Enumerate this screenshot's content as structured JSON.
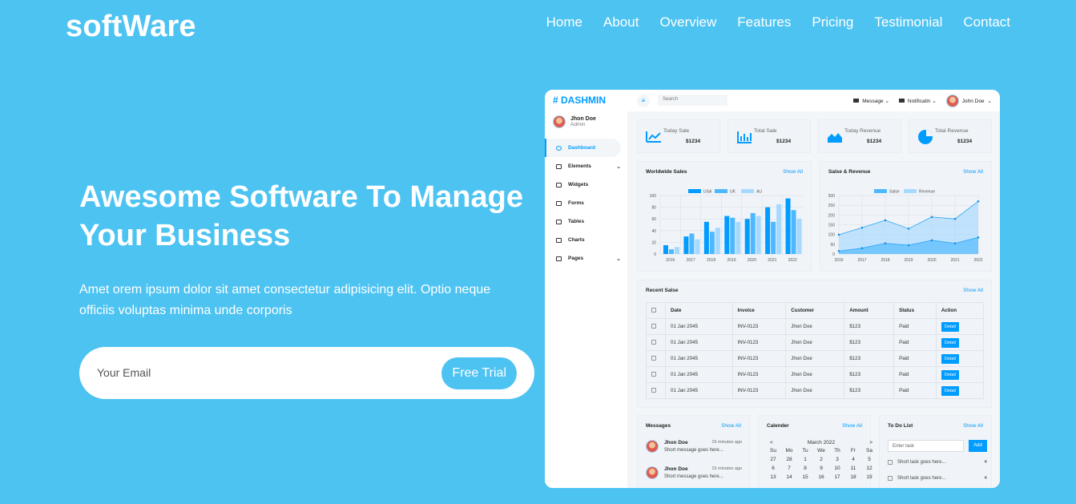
{
  "header": {
    "logo": "softWare",
    "nav": [
      "Home",
      "About",
      "Overview",
      "Features",
      "Pricing",
      "Testimonial",
      "Contact"
    ]
  },
  "hero": {
    "title_line1": "Awesome Software To Manage",
    "title_line2": "Your Business",
    "text": "Amet orem ipsum dolor sit amet consectetur adipisicing elit. Optio neque officiis voluptas minima unde corporis",
    "email_placeholder": "Your Email",
    "cta": "Free Trial"
  },
  "dashboard": {
    "brand": "# DASHMIN",
    "user": {
      "name": "Jhon Doe",
      "role": "Admin"
    },
    "menu": [
      {
        "label": "Dashboard",
        "expand": false
      },
      {
        "label": "Elements",
        "expand": true
      },
      {
        "label": "Widgets",
        "expand": false
      },
      {
        "label": "Forms",
        "expand": false
      },
      {
        "label": "Tables",
        "expand": false
      },
      {
        "label": "Charts",
        "expand": false
      },
      {
        "label": "Pages",
        "expand": true
      }
    ],
    "search_placeholder": "Search",
    "topbar": {
      "message": "Message",
      "notification": "Notificatin",
      "profile": "John Doe"
    },
    "stats": [
      {
        "label": "Today Sale",
        "value": "$1234",
        "icon": "line-chart-icon"
      },
      {
        "label": "Total Sale",
        "value": "$1234",
        "icon": "bar-chart-icon"
      },
      {
        "label": "Today Revenue",
        "value": "$1234",
        "icon": "area-chart-icon"
      },
      {
        "label": "Total Revenue",
        "value": "$1234",
        "icon": "pie-chart-icon"
      }
    ],
    "worldwide": {
      "title": "Worldwide Sales",
      "show_all": "Show All"
    },
    "salesrev": {
      "title": "Salse & Revenue",
      "show_all": "Show All"
    },
    "recent": {
      "title": "Recent Salse",
      "show_all": "Show All",
      "columns": [
        "Date",
        "Invoice",
        "Customer",
        "Amount",
        "Status",
        "Action"
      ],
      "rows": [
        [
          "01 Jan 2045",
          "INV-0123",
          "Jhon Doe",
          "$123",
          "Paid",
          "Detail"
        ],
        [
          "01 Jan 2045",
          "INV-0123",
          "Jhon Doe",
          "$123",
          "Paid",
          "Detail"
        ],
        [
          "01 Jan 2045",
          "INV-0123",
          "Jhon Doe",
          "$123",
          "Paid",
          "Detail"
        ],
        [
          "01 Jan 2045",
          "INV-0123",
          "Jhon Doe",
          "$123",
          "Paid",
          "Detail"
        ],
        [
          "01 Jan 2045",
          "INV-0123",
          "Jhon Doe",
          "$123",
          "Paid",
          "Detail"
        ]
      ]
    },
    "messages": {
      "title": "Messages",
      "show_all": "Show All",
      "items": [
        {
          "name": "Jhon Doe",
          "time": "15 minutes ago",
          "text": "Short message goes here..."
        },
        {
          "name": "Jhon Doe",
          "time": "15 minutes ago",
          "text": "Short message goes here..."
        }
      ]
    },
    "calendar": {
      "title": "Calender",
      "show_all": "Show All",
      "month": "March 2022",
      "prev": "<",
      "next": ">",
      "days": [
        "Su",
        "Mo",
        "Tu",
        "We",
        "Th",
        "Fr",
        "Sa"
      ],
      "dates": [
        "27",
        "28",
        "1",
        "2",
        "3",
        "4",
        "5",
        "6",
        "7",
        "8",
        "9",
        "10",
        "11",
        "12",
        "13",
        "14",
        "15",
        "16",
        "17",
        "18",
        "19"
      ]
    },
    "todo": {
      "title": "To Do List",
      "show_all": "Show All",
      "placeholder": "Enter task",
      "add": "Add",
      "items": [
        "Short task goes here...",
        "Short task goes here..."
      ],
      "delete": "×"
    }
  },
  "chart_data": [
    {
      "type": "bar",
      "categories": [
        "2016",
        "2017",
        "2018",
        "2019",
        "2020",
        "2021",
        "2022"
      ],
      "series": [
        {
          "name": "USA",
          "values": [
            15,
            30,
            55,
            65,
            60,
            80,
            95
          ],
          "color": "#009cff"
        },
        {
          "name": "UK",
          "values": [
            8,
            35,
            38,
            62,
            70,
            55,
            75
          ],
          "color": "#4db8ff"
        },
        {
          "name": "AU",
          "values": [
            12,
            25,
            45,
            55,
            65,
            85,
            60
          ],
          "color": "#a6d9ff"
        }
      ],
      "ylim": [
        0,
        100
      ],
      "yticks": [
        0,
        20,
        40,
        60,
        80,
        100
      ],
      "legend": "top"
    },
    {
      "type": "area",
      "categories": [
        "2016",
        "2017",
        "2018",
        "2019",
        "2020",
        "2021",
        "2022"
      ],
      "series": [
        {
          "name": "Salse",
          "values": [
            15,
            30,
            55,
            45,
            70,
            55,
            85
          ],
          "color": "#4db8ff"
        },
        {
          "name": "Revenue",
          "values": [
            99,
            135,
            173,
            130,
            190,
            180,
            270
          ],
          "color": "#a6d9ff"
        }
      ],
      "ylim": [
        0,
        300
      ],
      "yticks": [
        0,
        50,
        100,
        150,
        200,
        250,
        300
      ],
      "legend": "top"
    }
  ]
}
